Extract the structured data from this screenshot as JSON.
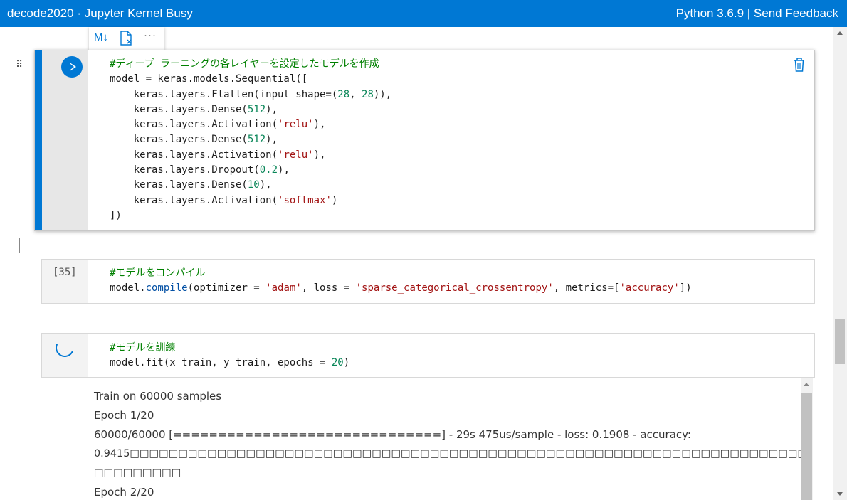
{
  "titlebar": {
    "title": "decode2020 · Jupyter Kernel Busy",
    "kernel": "Python 3.6.9 |",
    "feedback": "Send Feedback"
  },
  "cell_toolbar": {
    "markdown": "M↓",
    "clear_output_icon": "clear-output-icon",
    "more": "···"
  },
  "cells": [
    {
      "state": "selected",
      "run_icon": "play-icon",
      "delete_icon": "trash-icon",
      "lines": [
        "#ディープ ラーニングの各レイヤーを設定したモデルを作成",
        "model = keras.models.Sequential([",
        "    keras.layers.Flatten(input_shape=(28, 28)),",
        "    keras.layers.Dense(512),",
        "    keras.layers.Activation('relu'),",
        "    keras.layers.Dense(512),",
        "    keras.layers.Activation('relu'),",
        "    keras.layers.Dropout(0.2),",
        "    keras.layers.Dense(10),",
        "    keras.layers.Activation('softmax')",
        "])"
      ]
    },
    {
      "execution_count": "[35]",
      "lines": [
        "#モデルをコンパイル",
        "model.compile(optimizer = 'adam', loss = 'sparse_categorical_crossentropy', metrics=['accuracy'])"
      ]
    },
    {
      "state": "running",
      "lines": [
        "#モデルを訓練",
        "model.fit(x_train, y_train, epochs = 20)"
      ],
      "output": [
        "Train on 60000 samples",
        "Epoch 1/20",
        "60000/60000 [==============================] - 29s 475us/sample - loss: 0.1908 - accuracy:",
        "0.9415□□□□□□□□□□□□□□□□□□□□□□□□□□□□□□□□□□□□□□□□□□□□□□□□□□□□□□□□□□□□□□□□□□□□□□□□□□□□",
        "□□□□□□□□□",
        "Epoch 2/20"
      ]
    }
  ]
}
